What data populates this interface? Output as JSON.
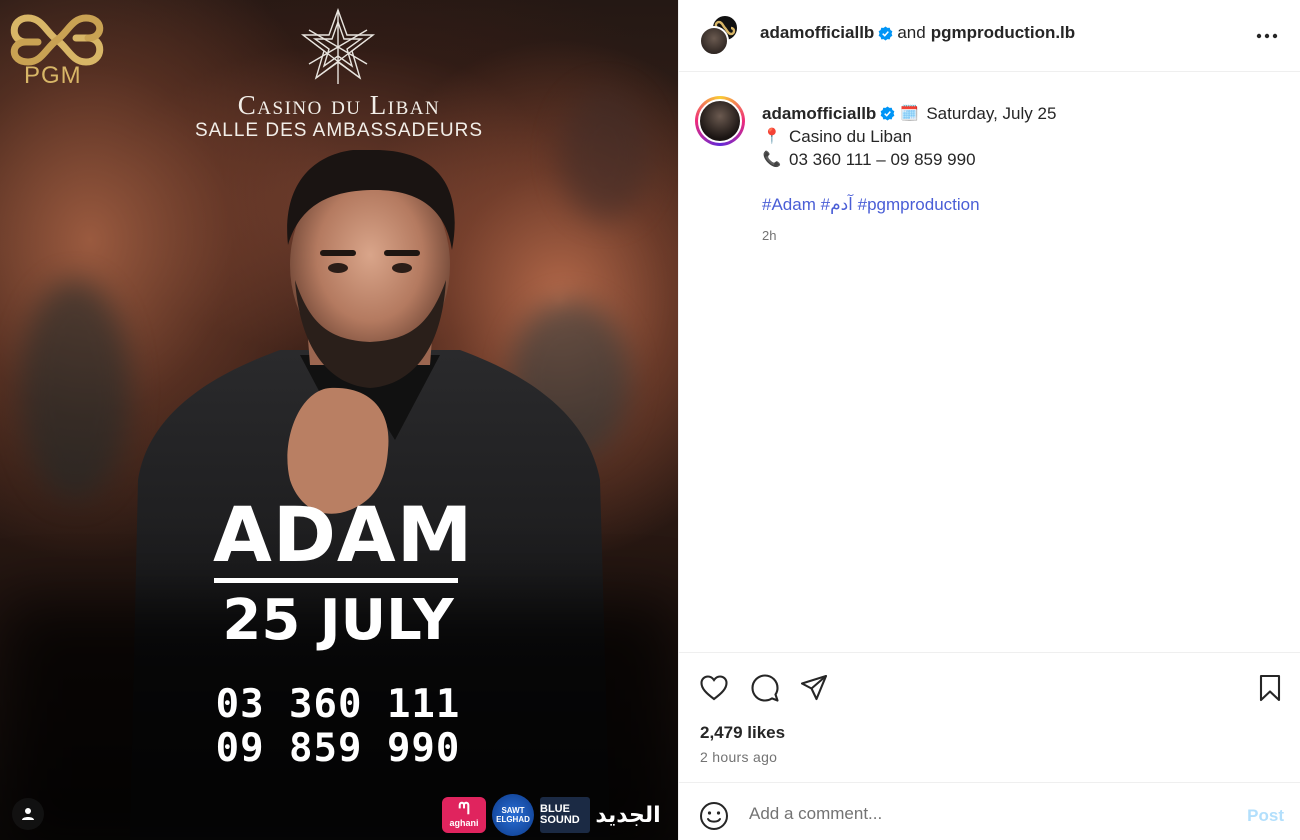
{
  "poster": {
    "logo_text": "PGM",
    "venue_title": "Casino du Liban",
    "venue_subtitle": "SALLE DES AMBASSADEURS",
    "artist": "ADAM",
    "date": "25 JULY",
    "phone_1": "03 360 111",
    "phone_2": "09 859 990",
    "sponsors": {
      "aghani": "aghani",
      "sawt_elghad": "SAWT ELGHAD",
      "blue_sound": "BLUE SOUND",
      "al_jadeed": "الجديد"
    }
  },
  "header": {
    "author": "adamofficiallb",
    "and_text": "and",
    "collaborator": "pgmproduction.lb"
  },
  "caption": {
    "author": "adamofficiallb",
    "date_emoji": "🗓️",
    "date_text": "Saturday, July 25",
    "location_emoji": "📍",
    "location_text": "Casino du Liban",
    "phone_emoji": "📞",
    "phone_text": "03 360 111 – 09 859 990",
    "hashtags": [
      "#Adam",
      "#آدم",
      "#pgmproduction"
    ],
    "time": "2h"
  },
  "stats": {
    "likes": "2,479 likes",
    "time_ago": "2 hours ago"
  },
  "comment": {
    "placeholder": "Add a comment...",
    "post_label": "Post"
  },
  "colors": {
    "verified": "#0095f6",
    "hashtag": "#4a5ed6",
    "post_disabled": "#b2dffc",
    "logo_gold": "#d8b667"
  }
}
